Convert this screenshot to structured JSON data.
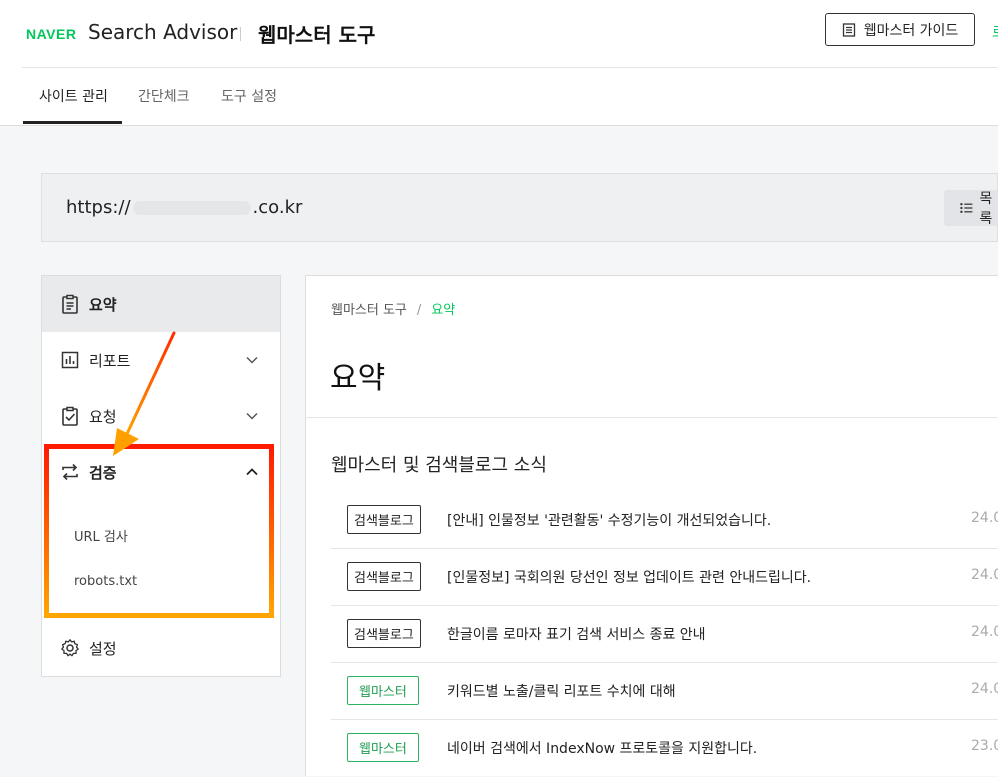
{
  "header": {
    "logo": "NAVER",
    "app_title": "Search Advisor",
    "tool_title": "웹마스터 도구",
    "guide_button": "웹마스터 가이드",
    "edge_text": "로"
  },
  "nav": {
    "tabs": [
      {
        "label": "사이트 관리",
        "active": true
      },
      {
        "label": "간단체크",
        "active": false
      },
      {
        "label": "도구 설정",
        "active": false
      }
    ]
  },
  "site": {
    "url_prefix": "https://",
    "url_suffix": ".co.kr",
    "list_button": "목록"
  },
  "sidebar": {
    "items": [
      {
        "label": "요약",
        "icon": "clipboard-icon",
        "active": true
      },
      {
        "label": "리포트",
        "icon": "chart-icon",
        "expanded": false
      },
      {
        "label": "요청",
        "icon": "clipboard-check-icon",
        "expanded": false
      },
      {
        "label": "검증",
        "icon": "swap-icon",
        "expanded": true,
        "subitems": [
          "URL 검사",
          "robots.txt"
        ]
      },
      {
        "label": "설정",
        "icon": "gear-icon"
      }
    ]
  },
  "main": {
    "breadcrumb": [
      "웹마스터 도구",
      "요약"
    ],
    "title": "요약",
    "section_title": "웹마스터 및 검색블로그 소식",
    "news": [
      {
        "badge": "검색블로그",
        "badge_type": "blog",
        "title": "[안내] 인물정보 '관련활동' 수정기능이 개선되었습니다.",
        "date": "24.0"
      },
      {
        "badge": "검색블로그",
        "badge_type": "blog",
        "title": "[인물정보] 국회의원 당선인 정보 업데이트 관련 안내드립니다.",
        "date": "24.0"
      },
      {
        "badge": "검색블로그",
        "badge_type": "blog",
        "title": "한글이름 로마자 표기 검색 서비스 종료 안내",
        "date": "24.0"
      },
      {
        "badge": "웹마스터",
        "badge_type": "webmaster",
        "title": "키워드별 노출/클릭 리포트 수치에 대해",
        "date": "24.0"
      },
      {
        "badge": "웹마스터",
        "badge_type": "webmaster",
        "title": "네이버 검색에서 IndexNow 프로토콜을 지원합니다.",
        "date": "23.0"
      }
    ]
  },
  "colors": {
    "brand": "#03c75a",
    "highlight_top": "#ff1a00",
    "highlight_bottom": "#ffa500"
  }
}
